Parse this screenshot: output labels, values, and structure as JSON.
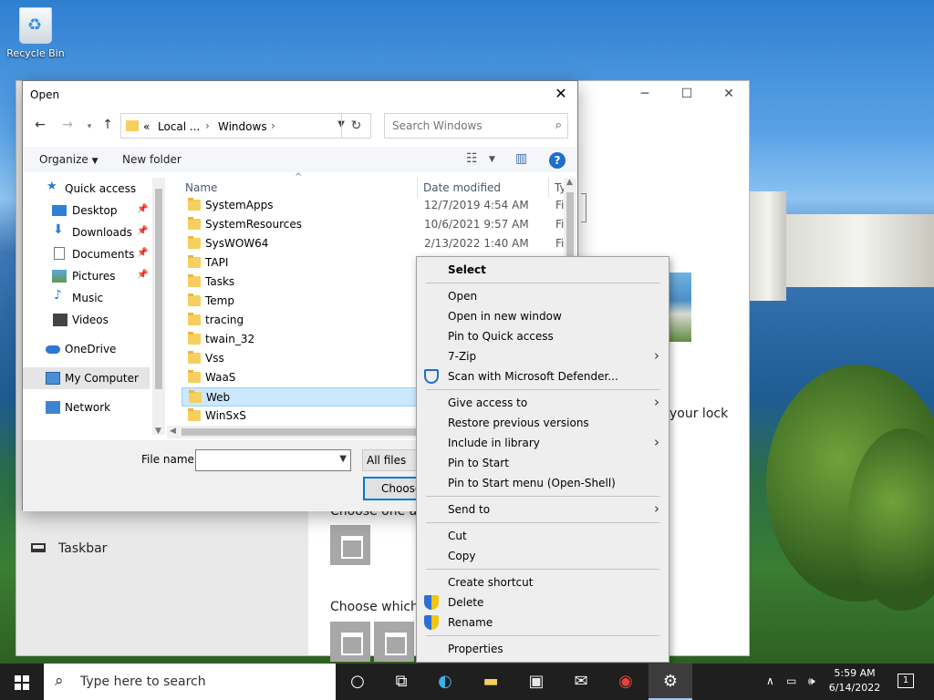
{
  "desktop": {
    "recycle_bin_label": "Recycle Bin"
  },
  "settings_window": {
    "lock_text": "your lock",
    "choose_one_app": "Choose one app",
    "choose_which_apps": "Choose which a",
    "taskbar_item": "Taskbar"
  },
  "dialog": {
    "title": "Open",
    "address": {
      "overflow": "«",
      "segments": [
        "Local ...",
        "Windows"
      ]
    },
    "search_placeholder": "Search Windows",
    "toolbar": {
      "organize": "Organize",
      "new_folder": "New folder"
    },
    "nav": [
      {
        "label": "Quick access",
        "icon": "star-icon"
      },
      {
        "label": "Desktop",
        "icon": "desktop-icon",
        "pinned": true
      },
      {
        "label": "Downloads",
        "icon": "download-icon",
        "pinned": true
      },
      {
        "label": "Documents",
        "icon": "documents-icon",
        "pinned": true
      },
      {
        "label": "Pictures",
        "icon": "pictures-icon",
        "pinned": true
      },
      {
        "label": "Music",
        "icon": "music-icon"
      },
      {
        "label": "Videos",
        "icon": "videos-icon"
      },
      {
        "label": "OneDrive",
        "icon": "cloud-icon"
      },
      {
        "label": "My Computer",
        "icon": "computer-icon",
        "selected": true
      },
      {
        "label": "Network",
        "icon": "network-icon"
      }
    ],
    "columns": {
      "name": "Name",
      "date_modified": "Date modified",
      "type": "Ty"
    },
    "files": [
      {
        "name": "SystemApps",
        "date": "12/7/2019 4:54 AM",
        "type": "Fi"
      },
      {
        "name": "SystemResources",
        "date": "10/6/2021 9:57 AM",
        "type": "Fi"
      },
      {
        "name": "SysWOW64",
        "date": "2/13/2022 1:40 AM",
        "type": "Fi"
      },
      {
        "name": "TAPI",
        "date": "",
        "type": ""
      },
      {
        "name": "Tasks",
        "date": "",
        "type": ""
      },
      {
        "name": "Temp",
        "date": "",
        "type": ""
      },
      {
        "name": "tracing",
        "date": "",
        "type": ""
      },
      {
        "name": "twain_32",
        "date": "",
        "type": ""
      },
      {
        "name": "Vss",
        "date": "",
        "type": ""
      },
      {
        "name": "WaaS",
        "date": "",
        "type": ""
      },
      {
        "name": "Web",
        "date": "",
        "type": "",
        "selected": true
      },
      {
        "name": "WinSxS",
        "date": "",
        "type": ""
      }
    ],
    "file_name_label": "File name:",
    "file_name_value": "",
    "filter_value": "All files",
    "choose_button": "Choose"
  },
  "context_menu": {
    "items": [
      {
        "label": "Select",
        "bold": true
      },
      {
        "label": "Open"
      },
      {
        "label": "Open in new window"
      },
      {
        "label": "Pin to Quick access"
      },
      {
        "label": "7-Zip",
        "submenu": true
      },
      {
        "label": "Scan with Microsoft Defender...",
        "icon": "defender-icon"
      },
      {
        "label": "Give access to",
        "submenu": true
      },
      {
        "label": "Restore previous versions"
      },
      {
        "label": "Include in library",
        "submenu": true
      },
      {
        "label": "Pin to Start"
      },
      {
        "label": "Pin to Start menu (Open-Shell)"
      },
      {
        "label": "Send to",
        "submenu": true
      },
      {
        "label": "Cut"
      },
      {
        "label": "Copy"
      },
      {
        "label": "Create shortcut"
      },
      {
        "label": "Delete",
        "icon": "shield-icon"
      },
      {
        "label": "Rename",
        "icon": "shield-icon"
      },
      {
        "label": "Properties"
      }
    ]
  },
  "taskbar": {
    "search_placeholder": "Type here to search",
    "apps": [
      "task-view-icon",
      "edge-icon",
      "file-explorer-icon",
      "store-icon",
      "mail-icon",
      "chrome-icon",
      "settings-icon"
    ],
    "time": "5:59 AM",
    "date": "6/14/2022",
    "notification_count": "1"
  },
  "colors": {
    "accent": "#0078d7",
    "selection": "#cce8ff",
    "taskbar": "#1f1f1f",
    "folder": "#f5cf5f"
  }
}
